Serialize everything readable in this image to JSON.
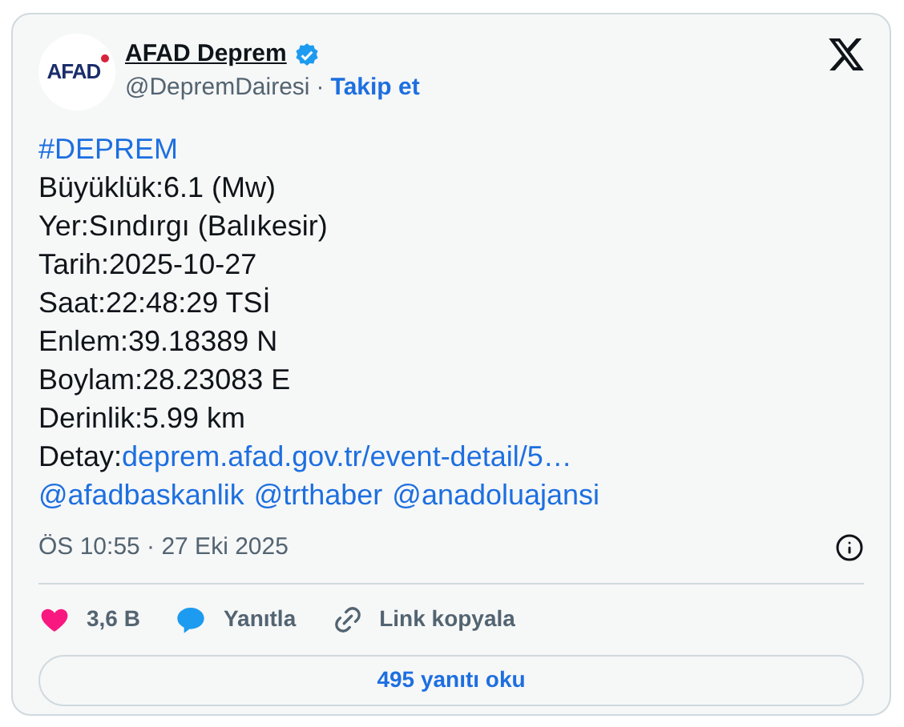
{
  "author": {
    "logo_text": "AFAD",
    "name": "AFAD Deprem",
    "verified": true,
    "handle": "@DepremDairesi",
    "separator": "·",
    "follow": "Takip et"
  },
  "body": [
    {
      "kind": "hashtag",
      "text": "#DEPREM"
    },
    {
      "kind": "plain",
      "text": "Büyüklük:6.1 (Mw)"
    },
    {
      "kind": "plain",
      "text": "Yer:Sındırgı (Balıkesir)"
    },
    {
      "kind": "plain",
      "text": "Tarih:2025-10-27"
    },
    {
      "kind": "plain",
      "text": "Saat:22:48:29 TSİ"
    },
    {
      "kind": "plain",
      "text": "Enlem:39.18389 N"
    },
    {
      "kind": "plain",
      "text": "Boylam:28.23083 E"
    },
    {
      "kind": "plain",
      "text": "Derinlik:5.99 km"
    },
    {
      "kind": "link",
      "text": "Detay:",
      "link": "deprem.afad.gov.tr/event-detail/5…"
    },
    {
      "kind": "mentions",
      "mentions": [
        "@afadbaskanlik",
        "@trthaber",
        "@anadoluajansi"
      ]
    }
  ],
  "timestamp": "ÖS 10:55 · 27 Eki 2025",
  "actions": [
    {
      "kind": "like",
      "label": "3,6 B"
    },
    {
      "kind": "reply",
      "label": "Yanıtla"
    },
    {
      "kind": "copy",
      "label": "Link kopyala"
    }
  ],
  "read_replies": "495 yanıtı oku"
}
